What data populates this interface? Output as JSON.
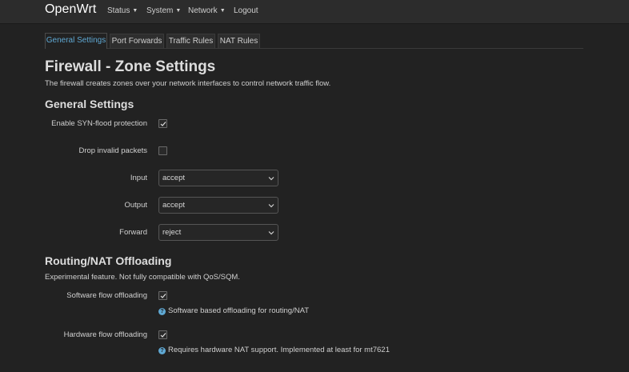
{
  "app": {
    "brand": "OpenWrt",
    "menu": [
      {
        "label": "Status",
        "has_dropdown": true
      },
      {
        "label": "System",
        "has_dropdown": true
      },
      {
        "label": "Network",
        "has_dropdown": true
      },
      {
        "label": "Logout",
        "has_dropdown": false
      }
    ]
  },
  "tabs": [
    {
      "label": "General Settings",
      "active": true
    },
    {
      "label": "Port Forwards",
      "active": false
    },
    {
      "label": "Traffic Rules",
      "active": false
    },
    {
      "label": "NAT Rules",
      "active": false
    }
  ],
  "page": {
    "title": "Firewall - Zone Settings",
    "description": "The firewall creates zones over your network interfaces to control network traffic flow."
  },
  "general": {
    "heading": "General Settings",
    "syn_flood": {
      "label": "Enable SYN-flood protection",
      "checked": true
    },
    "drop_invalid": {
      "label": "Drop invalid packets",
      "checked": false
    },
    "input": {
      "label": "Input",
      "value": "accept"
    },
    "output": {
      "label": "Output",
      "value": "accept"
    },
    "forward": {
      "label": "Forward",
      "value": "reject"
    }
  },
  "offloading": {
    "heading": "Routing/NAT Offloading",
    "description": "Experimental feature. Not fully compatible with QoS/SQM.",
    "software": {
      "label": "Software flow offloading",
      "checked": true,
      "help": "Software based offloading for routing/NAT"
    },
    "hardware": {
      "label": "Hardware flow offloading",
      "checked": true,
      "help": "Requires hardware NAT support. Implemented at least for mt7621"
    }
  },
  "colors": {
    "background": "#222222",
    "accent": "#5fa8d3",
    "topbar": "#2c2c2c"
  },
  "icons": {
    "caret": "caret-down-icon",
    "check": "check-icon",
    "help": "help-icon",
    "chevron": "chevron-down-icon"
  }
}
